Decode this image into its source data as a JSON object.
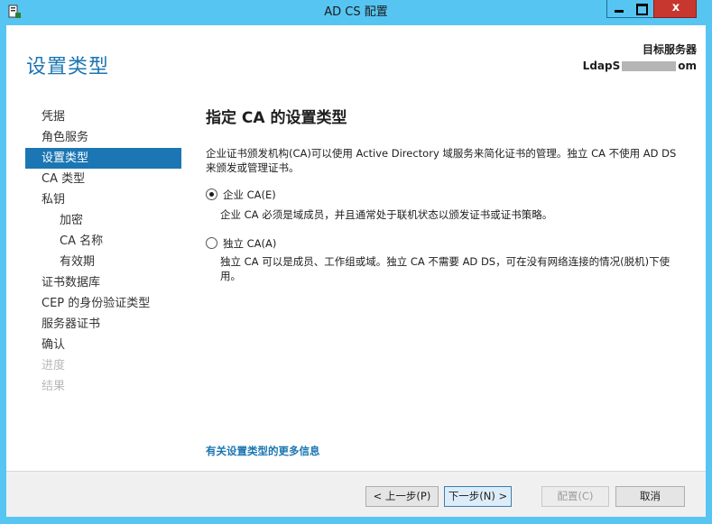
{
  "window": {
    "title": "AD CS 配置",
    "close_glyph": "x",
    "icon": "server-manager-icon"
  },
  "header": {
    "page_title": "设置类型",
    "server_caption": "目标服务器",
    "server_name_prefix": "LdapS",
    "server_name_suffix": "om"
  },
  "nav": {
    "items": [
      {
        "label": "凭据",
        "state": "normal"
      },
      {
        "label": "角色服务",
        "state": "normal"
      },
      {
        "label": "设置类型",
        "state": "active"
      },
      {
        "label": "CA 类型",
        "state": "normal"
      },
      {
        "label": "私钥",
        "state": "normal"
      },
      {
        "label": "加密",
        "state": "sub"
      },
      {
        "label": "CA 名称",
        "state": "sub"
      },
      {
        "label": "有效期",
        "state": "sub"
      },
      {
        "label": "证书数据库",
        "state": "normal"
      },
      {
        "label": "CEP 的身份验证类型",
        "state": "normal"
      },
      {
        "label": "服务器证书",
        "state": "normal"
      },
      {
        "label": "确认",
        "state": "normal"
      },
      {
        "label": "进度",
        "state": "disabled"
      },
      {
        "label": "结果",
        "state": "disabled"
      }
    ]
  },
  "main": {
    "heading": "指定 CA 的设置类型",
    "description": "企业证书颁发机构(CA)可以使用 Active Directory 域服务来简化证书的管理。独立 CA 不使用 AD DS 来颁发或管理证书。",
    "options": [
      {
        "label": "企业 CA(E)",
        "checked": true,
        "description": "企业 CA 必须是域成员，并且通常处于联机状态以颁发证书或证书策略。"
      },
      {
        "label": "独立 CA(A)",
        "checked": false,
        "description": "独立 CA 可以是成员、工作组或域。独立 CA 不需要 AD DS，可在没有网络连接的情况(脱机)下使用。"
      }
    ],
    "more_info_link": "有关设置类型的更多信息"
  },
  "footer": {
    "prev": "< 上一步(P)",
    "next": "下一步(N) >",
    "configure": "配置(C)",
    "cancel": "取消"
  },
  "colors": {
    "accent": "#1b76b3",
    "titlebar": "#57c5f2",
    "close": "#c7372f"
  }
}
